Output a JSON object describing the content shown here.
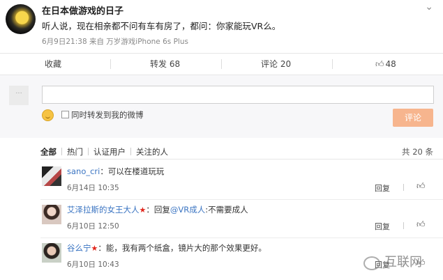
{
  "post": {
    "username": "在日本做游戏的日子",
    "text": "听人说，现在相亲都不问有车有房了，都问：你家能玩VR么。",
    "meta": "6月9日21:38 来自 万岁游戏iPhone 6s Plus",
    "more_icon": "chevron-down-icon"
  },
  "actions": {
    "favorite": "收藏",
    "repost": "转发 68",
    "comment": "评论 20",
    "like": "48"
  },
  "composer": {
    "avatar_text": "···",
    "input_value": "",
    "repost_label": "同时转发到我的微博",
    "submit_label": "评论"
  },
  "filters": {
    "items": [
      "全部",
      "热门",
      "认证用户",
      "关注的人"
    ],
    "total": "共 20 条"
  },
  "comments": [
    {
      "user": "sano_cri",
      "text": "：可以在楼道玩玩",
      "time": "6月14日 10:35",
      "reply": "回复"
    },
    {
      "user": "艾泽拉斯的女王大人",
      "star": "★",
      "text_prefix": "：回复",
      "mention": "@VR成人",
      "text": ":不需要成人",
      "time": "6月10日 12:50",
      "reply": "回复"
    },
    {
      "user": "谷么宁",
      "star": "★",
      "text": "：能，我有两个纸盒，镜片大的那个效果更好。",
      "time": "6月10日 10:43",
      "reply": "回复"
    }
  ],
  "watermark": {
    "text": "互联网"
  },
  "colors": {
    "link": "#3a74c2",
    "submit_disabled": "#f7b58e",
    "star": "#e1251b"
  }
}
